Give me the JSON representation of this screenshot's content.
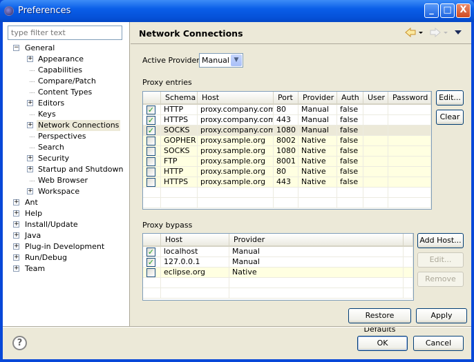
{
  "window": {
    "title": "Preferences",
    "minimize": "_",
    "maximize": "□",
    "close": "X"
  },
  "colors": {
    "title_bar": "#0551d8",
    "dialog_bg": "#ECE9D8",
    "native_row_bg": "#FFFFE1",
    "selected_row_bg": "#ECE9D8",
    "check": "#21a121"
  },
  "filter": {
    "placeholder": "type filter text"
  },
  "tree": [
    {
      "label": "General",
      "level": 0,
      "expander": "minus"
    },
    {
      "label": "Appearance",
      "level": 1,
      "expander": "plus"
    },
    {
      "label": "Capabilities",
      "level": 1,
      "expander": "none"
    },
    {
      "label": "Compare/Patch",
      "level": 1,
      "expander": "none"
    },
    {
      "label": "Content Types",
      "level": 1,
      "expander": "none"
    },
    {
      "label": "Editors",
      "level": 1,
      "expander": "plus"
    },
    {
      "label": "Keys",
      "level": 1,
      "expander": "none"
    },
    {
      "label": "Network Connections",
      "level": 1,
      "expander": "plus",
      "selected": true
    },
    {
      "label": "Perspectives",
      "level": 1,
      "expander": "none"
    },
    {
      "label": "Search",
      "level": 1,
      "expander": "none"
    },
    {
      "label": "Security",
      "level": 1,
      "expander": "plus"
    },
    {
      "label": "Startup and Shutdown",
      "level": 1,
      "expander": "plus"
    },
    {
      "label": "Web Browser",
      "level": 1,
      "expander": "none"
    },
    {
      "label": "Workspace",
      "level": 1,
      "expander": "plus"
    },
    {
      "label": "Ant",
      "level": 0,
      "expander": "plus"
    },
    {
      "label": "Help",
      "level": 0,
      "expander": "plus"
    },
    {
      "label": "Install/Update",
      "level": 0,
      "expander": "plus"
    },
    {
      "label": "Java",
      "level": 0,
      "expander": "plus"
    },
    {
      "label": "Plug-in Development",
      "level": 0,
      "expander": "plus"
    },
    {
      "label": "Run/Debug",
      "level": 0,
      "expander": "plus"
    },
    {
      "label": "Team",
      "level": 0,
      "expander": "plus"
    }
  ],
  "page": {
    "title": "Network Connections",
    "nav_icons": [
      "back-arrow-icon",
      "forward-arrow-icon",
      "view-menu-icon"
    ],
    "active_provider_label": "Active Provider:",
    "active_provider_value": "Manual",
    "proxy_entries_label": "Proxy entries",
    "proxy_bypass_label": "Proxy bypass"
  },
  "proxy_entries": {
    "columns": [
      "",
      "Schema",
      "Host",
      "Port",
      "Provider",
      "Auth",
      "User",
      "Password"
    ],
    "rows": [
      {
        "checked": true,
        "schema": "HTTP",
        "host": "proxy.company.com",
        "port": "80",
        "provider": "Manual",
        "auth": "false",
        "user": "",
        "password": ""
      },
      {
        "checked": true,
        "schema": "HTTPS",
        "host": "proxy.company.com",
        "port": "443",
        "provider": "Manual",
        "auth": "false",
        "user": "",
        "password": ""
      },
      {
        "checked": true,
        "schema": "SOCKS",
        "host": "proxy.company.com",
        "port": "1080",
        "provider": "Manual",
        "auth": "false",
        "user": "",
        "password": "",
        "selected": true
      },
      {
        "checked": false,
        "schema": "GOPHER",
        "host": "proxy.sample.org",
        "port": "8002",
        "provider": "Native",
        "auth": "false",
        "user": "",
        "password": ""
      },
      {
        "checked": false,
        "schema": "SOCKS",
        "host": "proxy.sample.org",
        "port": "1080",
        "provider": "Native",
        "auth": "false",
        "user": "",
        "password": ""
      },
      {
        "checked": false,
        "schema": "FTP",
        "host": "proxy.sample.org",
        "port": "8001",
        "provider": "Native",
        "auth": "false",
        "user": "",
        "password": ""
      },
      {
        "checked": false,
        "schema": "HTTP",
        "host": "proxy.sample.org",
        "port": "80",
        "provider": "Native",
        "auth": "false",
        "user": "",
        "password": ""
      },
      {
        "checked": false,
        "schema": "HTTPS",
        "host": "proxy.sample.org",
        "port": "443",
        "provider": "Native",
        "auth": "false",
        "user": "",
        "password": ""
      }
    ],
    "buttons": {
      "edit": "Edit...",
      "clear": "Clear"
    }
  },
  "proxy_bypass": {
    "columns": [
      "",
      "Host",
      "Provider",
      ""
    ],
    "rows": [
      {
        "checked": true,
        "host": "localhost",
        "provider": "Manual"
      },
      {
        "checked": true,
        "host": "127.0.0.1",
        "provider": "Manual"
      },
      {
        "checked": false,
        "host": "eclipse.org",
        "provider": "Native"
      }
    ],
    "buttons": {
      "add_host": "Add Host...",
      "edit": "Edit...",
      "remove": "Remove"
    }
  },
  "footer": {
    "restore_defaults": "Restore Defaults",
    "apply": "Apply",
    "ok": "OK",
    "cancel": "Cancel",
    "help": "?"
  }
}
